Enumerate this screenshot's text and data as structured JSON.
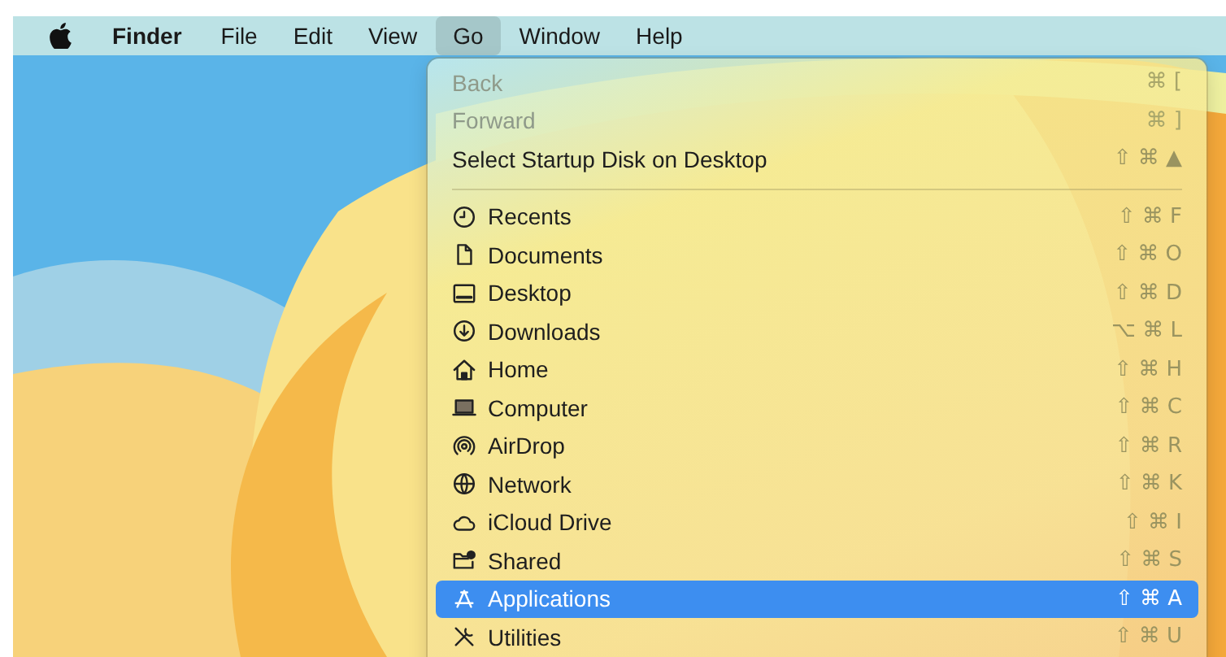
{
  "menu_bar": {
    "items": [
      {
        "label": "Finder",
        "selected": false,
        "kind": "app"
      },
      {
        "label": "File",
        "selected": false,
        "kind": "menu"
      },
      {
        "label": "Edit",
        "selected": false,
        "kind": "menu"
      },
      {
        "label": "View",
        "selected": false,
        "kind": "menu"
      },
      {
        "label": "Go",
        "selected": true,
        "kind": "menu"
      },
      {
        "label": "Window",
        "selected": false,
        "kind": "menu"
      },
      {
        "label": "Help",
        "selected": false,
        "kind": "menu"
      }
    ]
  },
  "go_menu": {
    "items": [
      {
        "kind": "command",
        "label": "Back",
        "shortcut": "⌘ [",
        "disabled": true,
        "selected": false
      },
      {
        "kind": "command",
        "label": "Forward",
        "shortcut": "⌘ ]",
        "disabled": true,
        "selected": false
      },
      {
        "kind": "command",
        "label": "Select Startup Disk on Desktop",
        "shortcut": "⇧ ⌘ ▲",
        "disabled": false,
        "selected": false
      },
      {
        "kind": "separator"
      },
      {
        "kind": "place",
        "label": "Recents",
        "shortcut": "⇧ ⌘ F",
        "disabled": false,
        "selected": false
      },
      {
        "kind": "place",
        "label": "Documents",
        "shortcut": "⇧ ⌘ O",
        "disabled": false,
        "selected": false
      },
      {
        "kind": "place",
        "label": "Desktop",
        "shortcut": "⇧ ⌘ D",
        "disabled": false,
        "selected": false
      },
      {
        "kind": "place",
        "label": "Downloads",
        "shortcut": "⌥ ⌘ L",
        "disabled": false,
        "selected": false
      },
      {
        "kind": "place",
        "label": "Home",
        "shortcut": "⇧ ⌘ H",
        "disabled": false,
        "selected": false
      },
      {
        "kind": "place",
        "label": "Computer",
        "shortcut": "⇧ ⌘ C",
        "disabled": false,
        "selected": false
      },
      {
        "kind": "place",
        "label": "AirDrop",
        "shortcut": "⇧ ⌘ R",
        "disabled": false,
        "selected": false
      },
      {
        "kind": "place",
        "label": "Network",
        "shortcut": "⇧ ⌘ K",
        "disabled": false,
        "selected": false
      },
      {
        "kind": "place",
        "label": "iCloud Drive",
        "shortcut": "⇧ ⌘ I",
        "disabled": false,
        "selected": false
      },
      {
        "kind": "place",
        "label": "Shared",
        "shortcut": "⇧ ⌘ S",
        "disabled": false,
        "selected": false
      },
      {
        "kind": "place",
        "label": "Applications",
        "shortcut": "⇧ ⌘ A",
        "disabled": false,
        "selected": true
      },
      {
        "kind": "place",
        "label": "Utilities",
        "shortcut": "⇧ ⌘ U",
        "disabled": false,
        "selected": false
      }
    ]
  }
}
